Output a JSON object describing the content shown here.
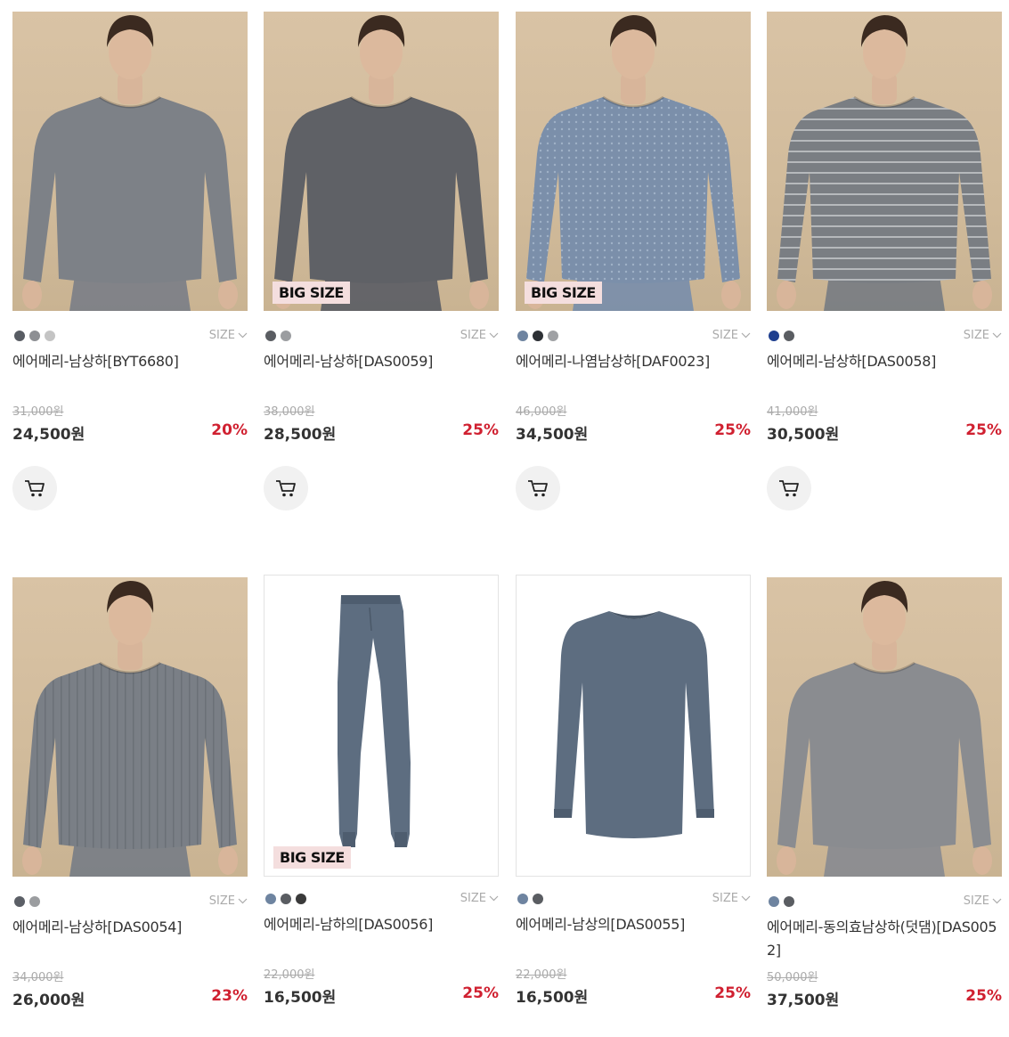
{
  "badge_big_size": "BIG SIZE",
  "size_label": "SIZE",
  "products": [
    {
      "name": "에어메리-남상하[BYT6680]",
      "original_price": "31,000원",
      "price": "24,500원",
      "discount": "20%",
      "swatches": [
        "#585c63",
        "#8d8f93",
        "#c4c4c4"
      ],
      "big_size": false,
      "image": "model-top-gray-knit"
    },
    {
      "name": "에어메리-남상하[DAS0059]",
      "original_price": "38,000원",
      "price": "28,500원",
      "discount": "25%",
      "swatches": [
        "#5a5d62",
        "#9b9da0"
      ],
      "big_size": true,
      "image": "model-top-charcoal"
    },
    {
      "name": "에어메리-나염남상하[DAF0023]",
      "original_price": "46,000원",
      "price": "34,500원",
      "discount": "25%",
      "swatches": [
        "#6e84a0",
        "#2d3035",
        "#9fa1a4"
      ],
      "big_size": true,
      "image": "model-top-blue-pattern"
    },
    {
      "name": "에어메리-남상하[DAS0058]",
      "original_price": "41,000원",
      "price": "30,500원",
      "discount": "25%",
      "swatches": [
        "#1f3f8f",
        "#5a5d62"
      ],
      "big_size": false,
      "image": "model-top-gray-stripe"
    },
    {
      "name": "에어메리-남상하[DAS0054]",
      "original_price": "34,000원",
      "price": "26,000원",
      "discount": "23%",
      "swatches": [
        "#5b5f66",
        "#9b9da0"
      ],
      "big_size": false,
      "image": "model-top-gray-rib"
    },
    {
      "name": "에어메리-남하의[DAS0056]",
      "original_price": "22,000원",
      "price": "16,500원",
      "discount": "25%",
      "swatches": [
        "#6e84a0",
        "#5a5d62",
        "#3a3a3a"
      ],
      "big_size": true,
      "image": "product-long-johns"
    },
    {
      "name": "에어메리-남상의[DAS0055]",
      "original_price": "22,000원",
      "price": "16,500원",
      "discount": "25%",
      "swatches": [
        "#6e84a0",
        "#5a5d62"
      ],
      "big_size": false,
      "image": "product-long-sleeve-top"
    },
    {
      "name": "에어메리-동의효남상하(덧댐)[DAS0052]",
      "original_price": "50,000원",
      "price": "37,500원",
      "discount": "25%",
      "swatches": [
        "#6e84a0",
        "#5a5d62"
      ],
      "big_size": false,
      "image": "model-top-heather-gray"
    }
  ],
  "colors": {
    "discount": "#d02030",
    "beige_bg": "#d6c0a1",
    "shirt_gray": "#7d8187",
    "shirt_charcoal": "#5f6166",
    "shirt_blue": "#7b8faa",
    "shirt_stripe": "#7a7e83",
    "shirt_heather": "#8a8c90",
    "product_blue": "#5d6d80"
  },
  "icons": {
    "cart": "cart-icon",
    "size_chevron": "chevron-down-icon"
  }
}
